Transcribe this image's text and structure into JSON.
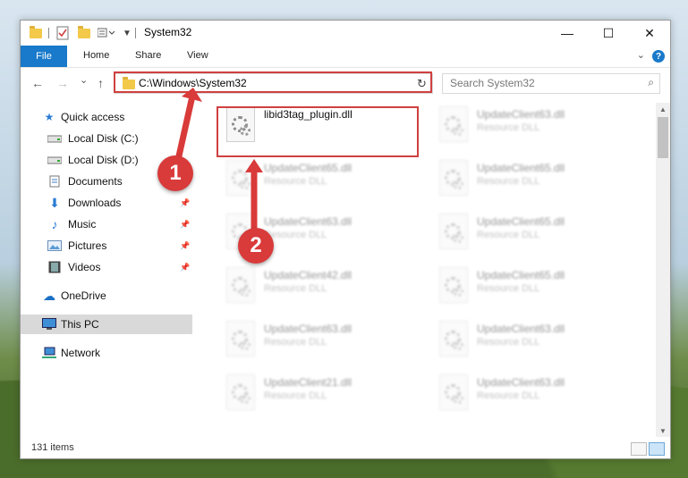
{
  "window": {
    "title": "System32",
    "controls": {
      "minimize": "—",
      "maximize": "☐",
      "close": "✕"
    }
  },
  "ribbon": {
    "tabs": [
      "File",
      "Home",
      "Share",
      "View"
    ],
    "collapse_icon": "chevron-down-icon",
    "help": "?"
  },
  "navigation": {
    "back": "←",
    "forward": "→",
    "recent": "⌄",
    "up": "↑",
    "address": "C:\\Windows\\System32",
    "refresh": "↻",
    "search_placeholder": "Search System32"
  },
  "sidebar": {
    "items": [
      {
        "label": "Quick access",
        "icon": "star-icon",
        "pinned": false
      },
      {
        "label": "Local Disk (C:)",
        "icon": "drive-icon",
        "pinned": false
      },
      {
        "label": "Local Disk (D:)",
        "icon": "drive-icon",
        "pinned": false
      },
      {
        "label": "Documents",
        "icon": "documents-icon",
        "pinned": false
      },
      {
        "label": "Downloads",
        "icon": "download-icon",
        "pinned": true
      },
      {
        "label": "Music",
        "icon": "music-icon",
        "pinned": true
      },
      {
        "label": "Pictures",
        "icon": "pictures-icon",
        "pinned": true
      },
      {
        "label": "Videos",
        "icon": "videos-icon",
        "pinned": true
      },
      {
        "label": "OneDrive",
        "icon": "cloud-icon",
        "pinned": false
      },
      {
        "label": "This PC",
        "icon": "computer-icon",
        "pinned": false,
        "selected": true
      },
      {
        "label": "Network",
        "icon": "network-icon",
        "pinned": false
      }
    ]
  },
  "files": [
    {
      "name": "libid3tag_plugin.dll",
      "type": "",
      "clear": true
    },
    {
      "name": "UpdateClient63.dll",
      "type": "Resource DLL"
    },
    {
      "name": "UpdateClient65.dll",
      "type": "Resource DLL"
    },
    {
      "name": "UpdateClient65.dll",
      "type": "Resource DLL"
    },
    {
      "name": "UpdateClient63.dll",
      "type": "Resource DLL"
    },
    {
      "name": "UpdateClient65.dll",
      "type": "Resource DLL"
    },
    {
      "name": "UpdateClient42.dll",
      "type": "Resource DLL"
    },
    {
      "name": "UpdateClient65.dll",
      "type": "Resource DLL"
    },
    {
      "name": "UpdateClient63.dll",
      "type": "Resource DLL"
    },
    {
      "name": "UpdateClient63.dll",
      "type": "Resource DLL"
    },
    {
      "name": "UpdateClient21.dll",
      "type": "Resource DLL"
    },
    {
      "name": "UpdateClient63.dll",
      "type": "Resource DLL"
    }
  ],
  "status": {
    "item_count": "131 items"
  },
  "annotations": {
    "step1": "1",
    "step2": "2",
    "highlight_color": "#d04040"
  }
}
